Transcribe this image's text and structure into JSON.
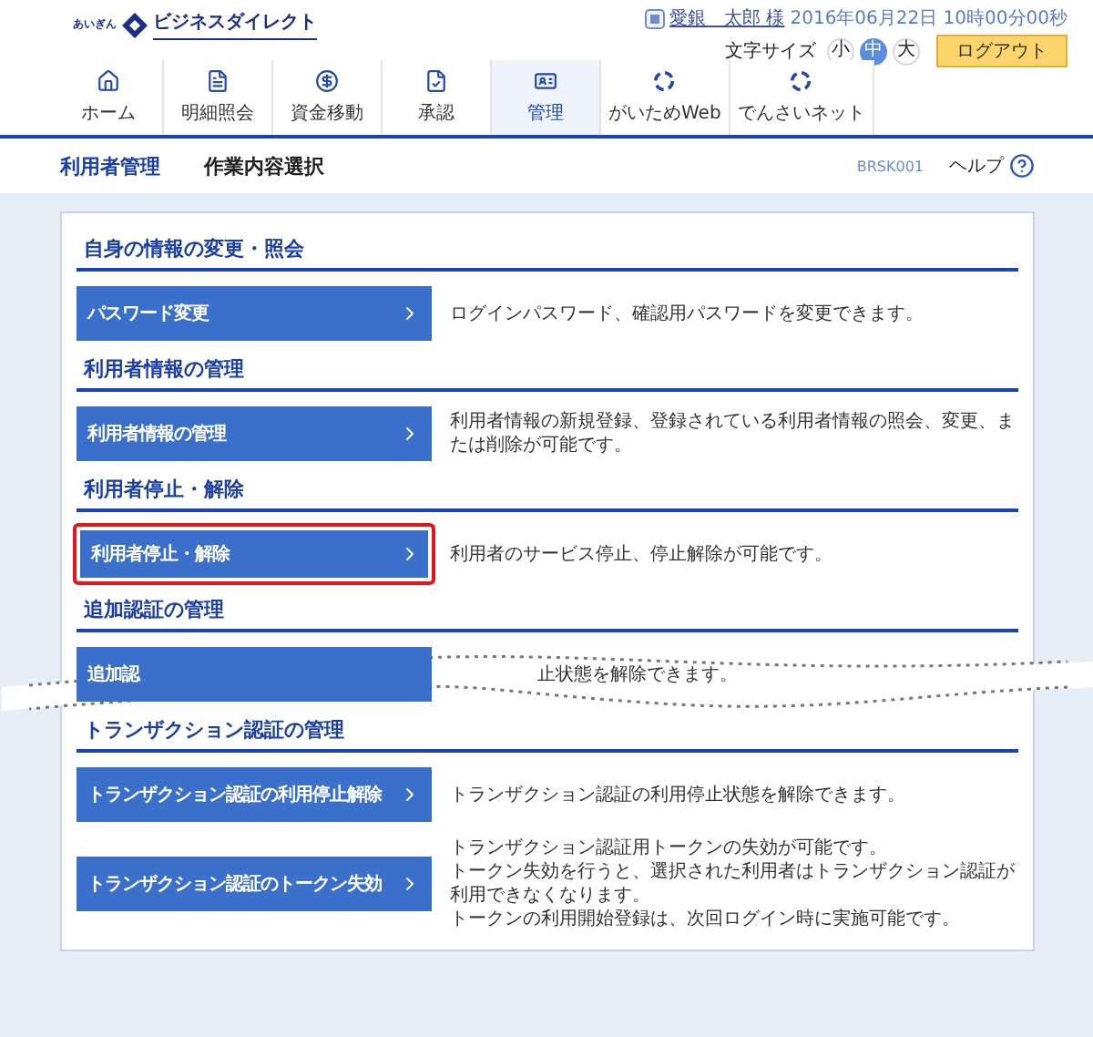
{
  "logo": {
    "prefix": "あいぎん",
    "name": "ビジネスダイレクト"
  },
  "user": {
    "name": "愛銀　太郎 様",
    "datetime": "2016年06月22日 10時00分00秒"
  },
  "font_size": {
    "label": "文字サイズ",
    "options": [
      {
        "label": "小",
        "selected": false
      },
      {
        "label": "中",
        "selected": true
      },
      {
        "label": "大",
        "selected": false
      }
    ]
  },
  "logout": "ログアウト",
  "nav": [
    {
      "label": "ホーム",
      "kind": "home",
      "selected": false
    },
    {
      "label": "明細照会",
      "kind": "document",
      "selected": false
    },
    {
      "label": "資金移動",
      "kind": "money",
      "selected": false
    },
    {
      "label": "承認",
      "kind": "approve",
      "selected": false
    },
    {
      "label": "管理",
      "kind": "admin",
      "selected": true
    },
    {
      "label": "がいためWeb",
      "kind": "ring",
      "selected": false
    },
    {
      "label": "でんさいネット",
      "kind": "ring",
      "selected": false
    }
  ],
  "breadcrumb": {
    "section": "利用者管理",
    "page": "作業内容選択",
    "screen_id": "BRSK001",
    "help": "ヘルプ"
  },
  "sections": [
    {
      "title": "自身の情報の変更・照会",
      "items": [
        {
          "button": "パスワード変更",
          "description": [
            "ログインパスワード、確認用パスワードを変更できます。"
          ],
          "highlighted": false
        }
      ]
    },
    {
      "title": "利用者情報の管理",
      "items": [
        {
          "button": "利用者情報の管理",
          "description": [
            "利用者情報の新規登録、登録されている利用者情報の照会、変更、または削除が可能です。"
          ],
          "highlighted": false
        }
      ]
    },
    {
      "title": "利用者停止・解除",
      "items": [
        {
          "button": "利用者停止・解除",
          "description": [
            "利用者のサービス停止、停止解除が可能です。"
          ],
          "highlighted": true
        }
      ]
    },
    {
      "title": "追加認証の管理",
      "torn": true,
      "items": [
        {
          "button": "追加認",
          "description": [
            "止状態を解除できます。"
          ],
          "highlighted": false
        }
      ]
    },
    {
      "title": "トランザクション認証の管理",
      "items": [
        {
          "button": "トランザクション認証の利用停止解除",
          "description": [
            "トランザクション認証の利用停止状態を解除できます。"
          ],
          "highlighted": false
        },
        {
          "button": "トランザクション認証のトークン失効",
          "description": [
            "トランザクション認証用トークンの失効が可能です。",
            "トークン失効を行うと、選択された利用者はトランザクション認証が利用できなくなります。",
            "トークンの利用開始登録は、次回ログイン時に実施可能です。"
          ],
          "highlighted": false
        }
      ]
    }
  ]
}
